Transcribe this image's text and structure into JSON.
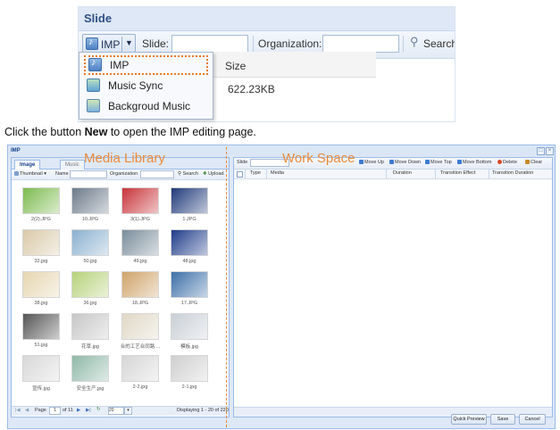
{
  "slide_panel": {
    "title": "Slide",
    "imp_button_label": "IMP",
    "slide_label": "Slide:",
    "organization_label": "Organization:",
    "search_label": "Search",
    "size_header": "Size",
    "size_value": "622.23KB",
    "menu_items": [
      {
        "label": "IMP",
        "icon": "music-note-icon"
      },
      {
        "label": "Music Sync",
        "icon": "music-sync-icon"
      },
      {
        "label": "Backgroud Music",
        "icon": "background-music-icon"
      }
    ]
  },
  "instruction": {
    "before": "Click the button ",
    "bold": "New",
    "after": " to open the IMP editing page."
  },
  "imp_window": {
    "title": "IMP",
    "media_library_label": "Media Library",
    "work_space_label": "Work Space",
    "left": {
      "tabs": [
        "Image",
        "Music"
      ],
      "view_label": "Thumbnail",
      "name_label": "Name",
      "organization_label": "Organization",
      "search_label": "Search",
      "upload_label": "Upload",
      "thumbnails": [
        {
          "caption": "2(2).JPG",
          "color": "#7dbb4f"
        },
        {
          "caption": "10.JPG",
          "color": "#6c7a8a"
        },
        {
          "caption": "3(1).JPG",
          "color": "#c8343a"
        },
        {
          "caption": "1.JPG",
          "color": "#203a7a"
        },
        {
          "caption": "32.jpg",
          "color": "#d9c9a8"
        },
        {
          "caption": "50.jpg",
          "color": "#8ab0cf"
        },
        {
          "caption": "49.jpg",
          "color": "#7a8d9b"
        },
        {
          "caption": "48.jpg",
          "color": "#1f3c8a"
        },
        {
          "caption": "38.jpg",
          "color": "#e6d6b0"
        },
        {
          "caption": "36.jpg",
          "color": "#b6d27a"
        },
        {
          "caption": "18.JPG",
          "color": "#cfa36a"
        },
        {
          "caption": "17.JPG",
          "color": "#3c6fa8"
        },
        {
          "caption": "51.jpg",
          "color": "#555555"
        },
        {
          "caption": "花草.jpg",
          "color": "#c6c6c6"
        },
        {
          "caption": "合的工艺合同路....",
          "color": "#e0d8c6"
        },
        {
          "caption": "模板.jpg",
          "color": "#c9cfd6"
        },
        {
          "caption": "宣传.jpg",
          "color": "#d8d8d8"
        },
        {
          "caption": "安全生产.jpg",
          "color": "#8fb8a8"
        },
        {
          "caption": "2-2.jpg",
          "color": "#d6d6d6"
        },
        {
          "caption": "2-1.jpg",
          "color": "#cfcfcf"
        }
      ],
      "pager": {
        "page_label": "Page",
        "page_value": "1",
        "of_label": "of 11",
        "per_page": "20",
        "displaying": "Displaying 1 - 20 of 220"
      }
    },
    "right": {
      "slide_label": "Slide",
      "toolbar": [
        "Move Up",
        "Move Down",
        "Move Top",
        "Move Bottom",
        "Delete",
        "Clear"
      ],
      "columns": [
        "Type",
        "Media",
        "Duration",
        "Transition Effect",
        "Transition Duration"
      ],
      "buttons": [
        "Quick Preview",
        "Save",
        "Cancel"
      ]
    }
  }
}
